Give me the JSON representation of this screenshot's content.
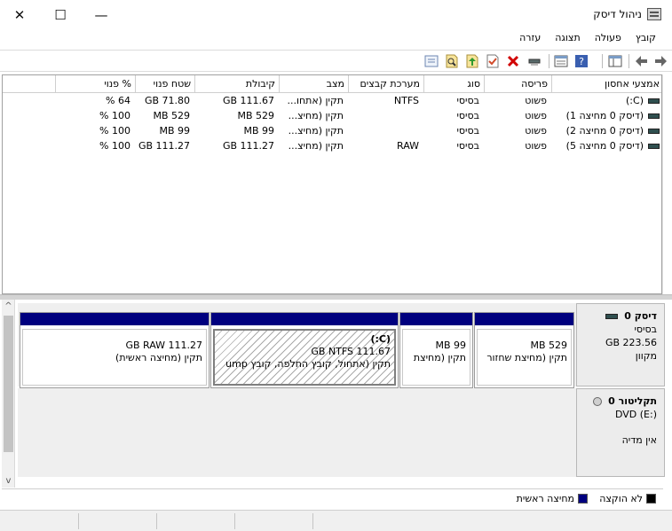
{
  "window": {
    "title": "ניהול דיסק",
    "close_glyph": "✕",
    "maximize_glyph": "☐",
    "minimize_glyph": "—"
  },
  "menu": [
    "קובץ",
    "פעולה",
    "תצוגה",
    "עזרה"
  ],
  "toolbar": {
    "icons": [
      "back-icon",
      "forward-icon",
      "show-hide-console-tree-icon",
      "help-icon",
      "properties-icon",
      "connect-icon",
      "delete-icon",
      "check-icon",
      "up-icon",
      "search-icon",
      "console-icon"
    ]
  },
  "volumes": {
    "headers": [
      "אמצעי אחסון",
      "פריסה",
      "סוג",
      "מערכת קבצים",
      "מצב",
      "קיבולת",
      "שטח פנוי",
      "% פנוי"
    ],
    "rows": [
      [
        "(C:)",
        "פשוט",
        "בסיסי",
        "NTFS",
        "תקין (אתחו...",
        "GB 111.67",
        "GB 71.80",
        "64 %"
      ],
      [
        "(דיסק 0 מחיצה 1)",
        "פשוט",
        "בסיסי",
        "",
        "תקין (מחיצ...",
        "MB 529",
        "MB 529",
        "100 %"
      ],
      [
        "(דיסק 0 מחיצה 2)",
        "פשוט",
        "בסיסי",
        "",
        "תקין (מחיצ...",
        "MB 99",
        "MB 99",
        "100 %"
      ],
      [
        "(דיסק 0 מחיצה 5)",
        "פשוט",
        "בסיסי",
        "RAW",
        "תקין (מחיצ...",
        "GB 111.27",
        "GB 111.27",
        "100 %"
      ]
    ]
  },
  "disk0": {
    "name": "דיסק 0",
    "type": "בסיסי",
    "size": "GB 223.56",
    "status": "מקוון",
    "partitions": [
      {
        "title": "",
        "line1": "MB 529",
        "line2": "תקין (מחיצת שחזור"
      },
      {
        "title": "",
        "line1": "MB 99",
        "line2": "תקין (מחיצת"
      },
      {
        "title": "(C:)",
        "line1": "GB NTFS 111.67",
        "line2": "תקין (אתחול, קובץ החלפה, קובץ ump"
      },
      {
        "title": "",
        "line1": "GB RAW 111.27",
        "line2": "תקין (מחיצה ראשית)"
      }
    ]
  },
  "cdrom0": {
    "name": "תקליטור 0",
    "drive": "DVD (E:)",
    "status": "אין מדיה"
  },
  "legend": {
    "unallocated": "לא הוקצה",
    "primary": "מחיצה ראשית",
    "unallocated_color": "#000000",
    "primary_color": "#00007f"
  },
  "scroll": {
    "up": "^",
    "down": "v"
  }
}
